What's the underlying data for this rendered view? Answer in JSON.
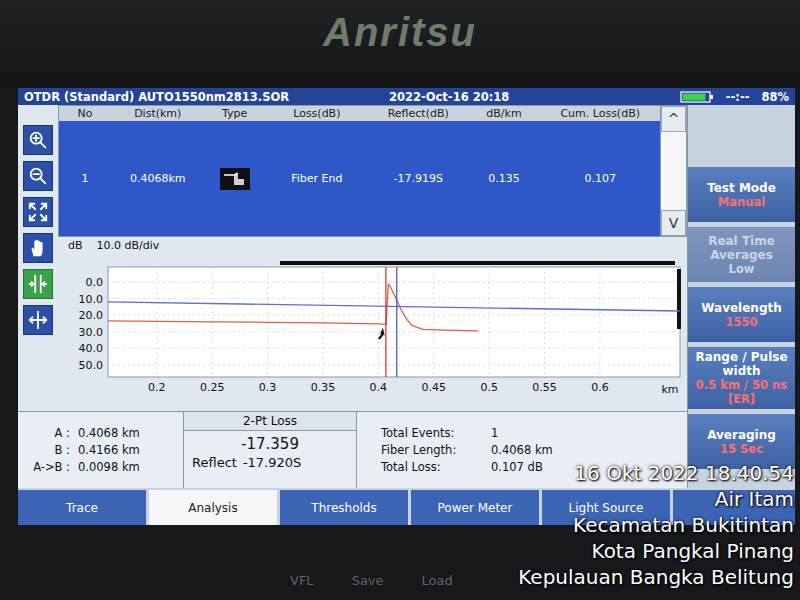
{
  "device": {
    "brand": "Anritsu"
  },
  "title_bar": {
    "title": "OTDR (Standard) AUTO1550nm2813.SOR",
    "datetime": "2022-Oct-16 20:18",
    "clock": "--:--",
    "battery": "88%",
    "battery_level": 0.88
  },
  "toolbar": [
    {
      "kind": "zoom-in",
      "selected": false
    },
    {
      "kind": "zoom-out",
      "selected": false
    },
    {
      "kind": "fit",
      "selected": false
    },
    {
      "kind": "hand",
      "selected": false
    },
    {
      "kind": "marker",
      "selected": true
    },
    {
      "kind": "cross",
      "selected": false
    }
  ],
  "event_table": {
    "columns": [
      "No",
      "Dist(km)",
      "Type",
      "Loss(dB)",
      "Reflect(dB)",
      "dB/km",
      "Cum. Loss(dB)"
    ],
    "rows": [
      {
        "no": "1",
        "dist": "0.4068km",
        "type": {
          "kind": "fiber-end"
        },
        "loss": "Fiber End",
        "reflect": "-17.919S",
        "db_km": "0.135",
        "cum_loss": "0.107",
        "selected": true
      }
    ],
    "scroll": [
      "^",
      "V"
    ]
  },
  "graph": {
    "y_label": "dB",
    "scale": "10.0 dB/div",
    "y_ticks": [
      {
        "label": "0.0",
        "value": 0
      },
      {
        "label": "10.0",
        "value": 10
      },
      {
        "label": "20.0",
        "value": 20
      },
      {
        "label": "30.0",
        "value": 30
      },
      {
        "label": "40.0",
        "value": 40
      },
      {
        "label": "50.0",
        "value": 50
      }
    ],
    "x_ticks": [
      {
        "label": "0.2",
        "value": 0.2
      },
      {
        "label": "0.25",
        "value": 0.25
      },
      {
        "label": "0.3",
        "value": 0.3
      },
      {
        "label": "0.35",
        "value": 0.35
      },
      {
        "label": "0.4",
        "value": 0.4
      },
      {
        "label": "0.45",
        "value": 0.45
      },
      {
        "label": "0.5",
        "value": 0.5
      },
      {
        "label": "0.55",
        "value": 0.55
      },
      {
        "label": "0.6",
        "value": 0.6
      }
    ],
    "x_unit": "km",
    "series": [
      {
        "color": "#e0603a",
        "km": [
          0.156,
          0.25,
          0.3,
          0.35,
          0.4,
          0.407,
          0.409,
          0.411,
          0.413,
          0.416,
          0.42,
          0.425,
          0.43,
          0.44,
          0.46,
          0.49
        ],
        "db": [
          23.5,
          24.0,
          24.3,
          24.7,
          25.2,
          25.6,
          1.5,
          3.0,
          6.0,
          10.0,
          16.0,
          22.0,
          26.0,
          28.5,
          29.0,
          29.5
        ]
      },
      {
        "color": "#5b6fd6",
        "km": [
          0.156,
          0.672
        ],
        "db": [
          12.0,
          17.5
        ]
      }
    ],
    "markers": [
      {
        "km": 0.4068,
        "color": "#d02a2a"
      },
      {
        "km": 0.4166,
        "color": "#3a4fd0"
      }
    ]
  },
  "cursors": [
    {
      "label": "A :",
      "value": "0.4068 km"
    },
    {
      "label": "B :",
      "value": "0.4166 km"
    },
    {
      "label": "A->B :",
      "value": "0.0098 km"
    }
  ],
  "two_point": {
    "title": "2-Pt Loss",
    "value": "-17.359",
    "reflect_label": "Reflect",
    "reflect_value": "-17.920S"
  },
  "summary": [
    {
      "label": "Total Events:",
      "value": "1"
    },
    {
      "label": "Fiber Length:",
      "value": "0.4068 km"
    },
    {
      "label": "Total Loss:",
      "value": "0.107 dB"
    }
  ],
  "softkeys": [
    {
      "title": "Test Mode",
      "value": "Manual",
      "disabled": false
    },
    {
      "title": "Real Time Averages",
      "value": "Low",
      "disabled": true
    },
    {
      "title": "Wavelength",
      "value": "1550",
      "disabled": false
    },
    {
      "title": "Range / Pulse width",
      "value": "0.5 km / 50 ns [ER]",
      "disabled": false
    },
    {
      "title": "Averaging",
      "value": "15 Sec",
      "disabled": false
    }
  ],
  "tabs": [
    {
      "label": "Trace",
      "selected": false
    },
    {
      "label": "Analysis",
      "selected": true
    },
    {
      "label": "Thresholds",
      "selected": false
    },
    {
      "label": "Power Meter",
      "selected": false
    },
    {
      "label": "Light Source",
      "selected": false
    }
  ],
  "bezel_keys": [
    "VFL",
    "Save",
    "Load"
  ],
  "watermark": [
    "16 Okt 2022 18.40.54",
    "Air Itam",
    "Kecamatan Bukitintan",
    "Kota Pangkal Pinang",
    "Kepulauan Bangka Belitung"
  ]
}
